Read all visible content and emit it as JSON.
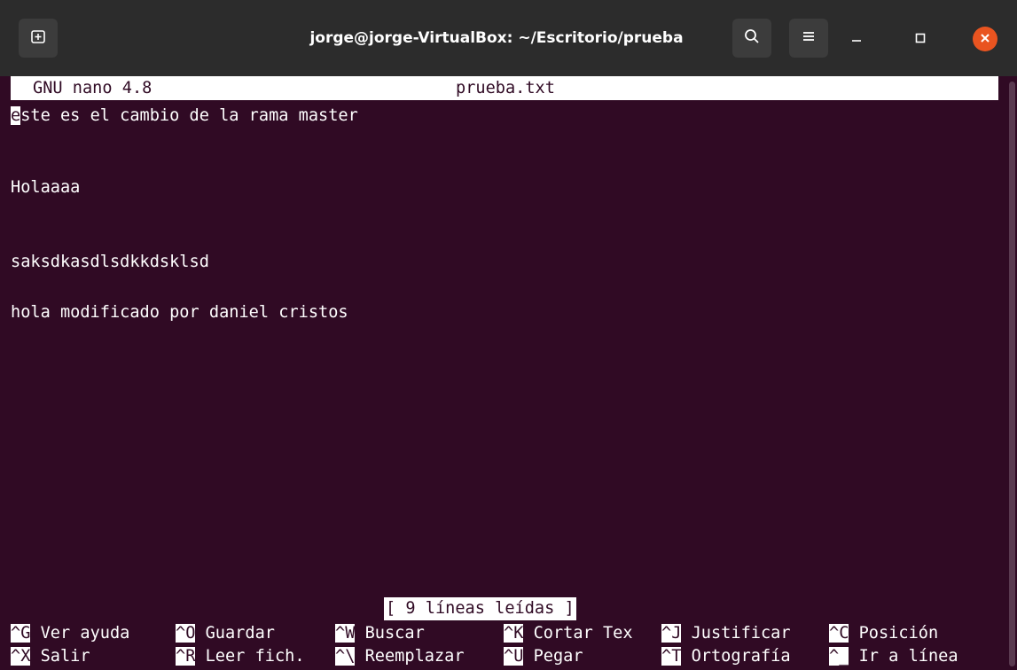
{
  "window": {
    "title": "jorge@jorge-VirtualBox: ~/Escritorio/prueba",
    "accent_color": "#e95420"
  },
  "icons": {
    "new_tab": "new-tab-icon",
    "search": "search-icon",
    "menu": "hamburger-menu-icon",
    "minimize": "minimize-icon",
    "maximize": "maximize-icon",
    "close": "close-icon"
  },
  "nano": {
    "version_label": "GNU nano 4.8",
    "filename": "prueba.txt",
    "lines": [
      "este es el cambio de la rama master",
      "",
      "Holaaaa",
      "",
      "saksdkasdlsdkkdsklsd",
      "",
      "hola modificado por daniel cristos"
    ],
    "cursor_char": "e",
    "first_line_rest": "ste es el cambio de la rama master",
    "status_message": "[ 9 líneas leídas ]",
    "shortcuts_row1": [
      {
        "key": "^G",
        "label": "Ver ayuda"
      },
      {
        "key": "^O",
        "label": "Guardar"
      },
      {
        "key": "^W",
        "label": "Buscar"
      },
      {
        "key": "^K",
        "label": "Cortar Tex"
      },
      {
        "key": "^J",
        "label": "Justificar"
      },
      {
        "key": "^C",
        "label": "Posición"
      }
    ],
    "shortcuts_row2": [
      {
        "key": "^X",
        "label": "Salir"
      },
      {
        "key": "^R",
        "label": "Leer fich."
      },
      {
        "key": "^\\",
        "label": "Reemplazar"
      },
      {
        "key": "^U",
        "label": "Pegar"
      },
      {
        "key": "^T",
        "label": "Ortografía"
      },
      {
        "key": "^_",
        "label": "Ir a línea"
      }
    ]
  },
  "colors": {
    "terminal_background": "#300a24",
    "titlebar_background": "#2c2c2c",
    "text": "#ffffff"
  }
}
